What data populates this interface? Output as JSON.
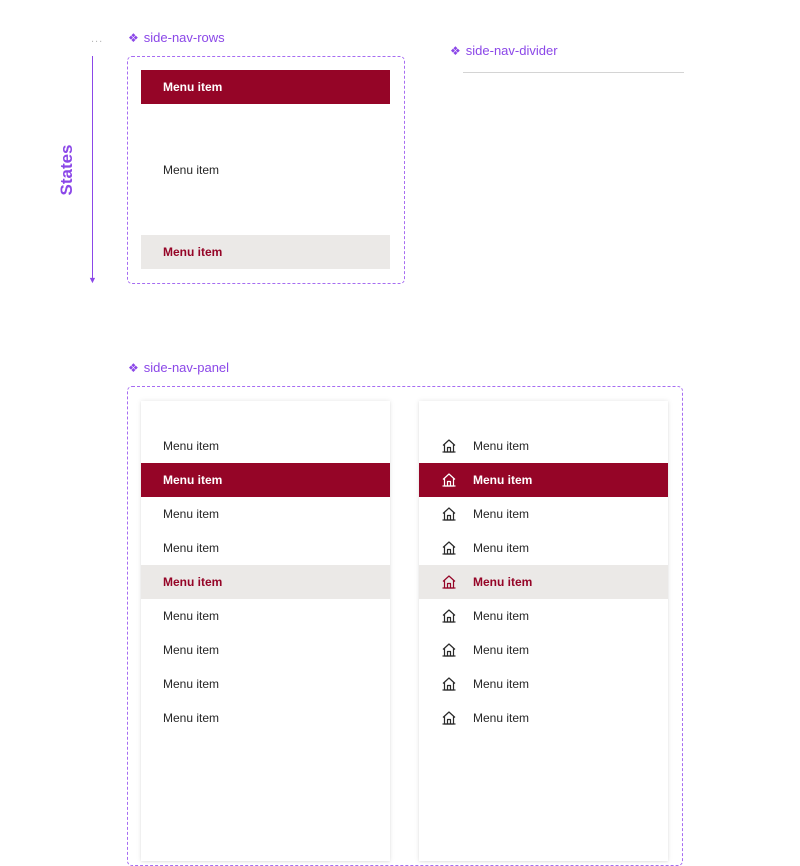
{
  "overflow_marker": "...",
  "components": {
    "rows": {
      "title": "side-nav-rows"
    },
    "divider": {
      "title": "side-nav-divider"
    },
    "panel": {
      "title": "side-nav-panel"
    }
  },
  "states_label": "States",
  "rows": [
    {
      "label": "Menu item",
      "state": "selected"
    },
    {
      "label": "Menu item",
      "state": "default"
    },
    {
      "label": "Menu item",
      "state": "hover"
    }
  ],
  "panels": [
    {
      "with_icons": false,
      "items": [
        {
          "label": "Menu item",
          "state": "default"
        },
        {
          "label": "Menu item",
          "state": "selected"
        },
        {
          "label": "Menu item",
          "state": "default"
        },
        {
          "label": "Menu item",
          "state": "default"
        },
        {
          "label": "Menu item",
          "state": "hover"
        },
        {
          "label": "Menu item",
          "state": "default"
        },
        {
          "label": "Menu item",
          "state": "default"
        },
        {
          "label": "Menu item",
          "state": "default"
        },
        {
          "label": "Menu item",
          "state": "default"
        }
      ]
    },
    {
      "with_icons": true,
      "icon": "home-icon",
      "items": [
        {
          "label": "Menu item",
          "state": "default"
        },
        {
          "label": "Menu item",
          "state": "selected"
        },
        {
          "label": "Menu item",
          "state": "default"
        },
        {
          "label": "Menu item",
          "state": "default"
        },
        {
          "label": "Menu item",
          "state": "hover"
        },
        {
          "label": "Menu item",
          "state": "default"
        },
        {
          "label": "Menu item",
          "state": "default"
        },
        {
          "label": "Menu item",
          "state": "default"
        },
        {
          "label": "Menu item",
          "state": "default"
        }
      ]
    }
  ],
  "colors": {
    "accent": "#8b47e8",
    "selected_bg": "#950527",
    "hover_bg": "#ebe9e7",
    "text": "#262626"
  }
}
